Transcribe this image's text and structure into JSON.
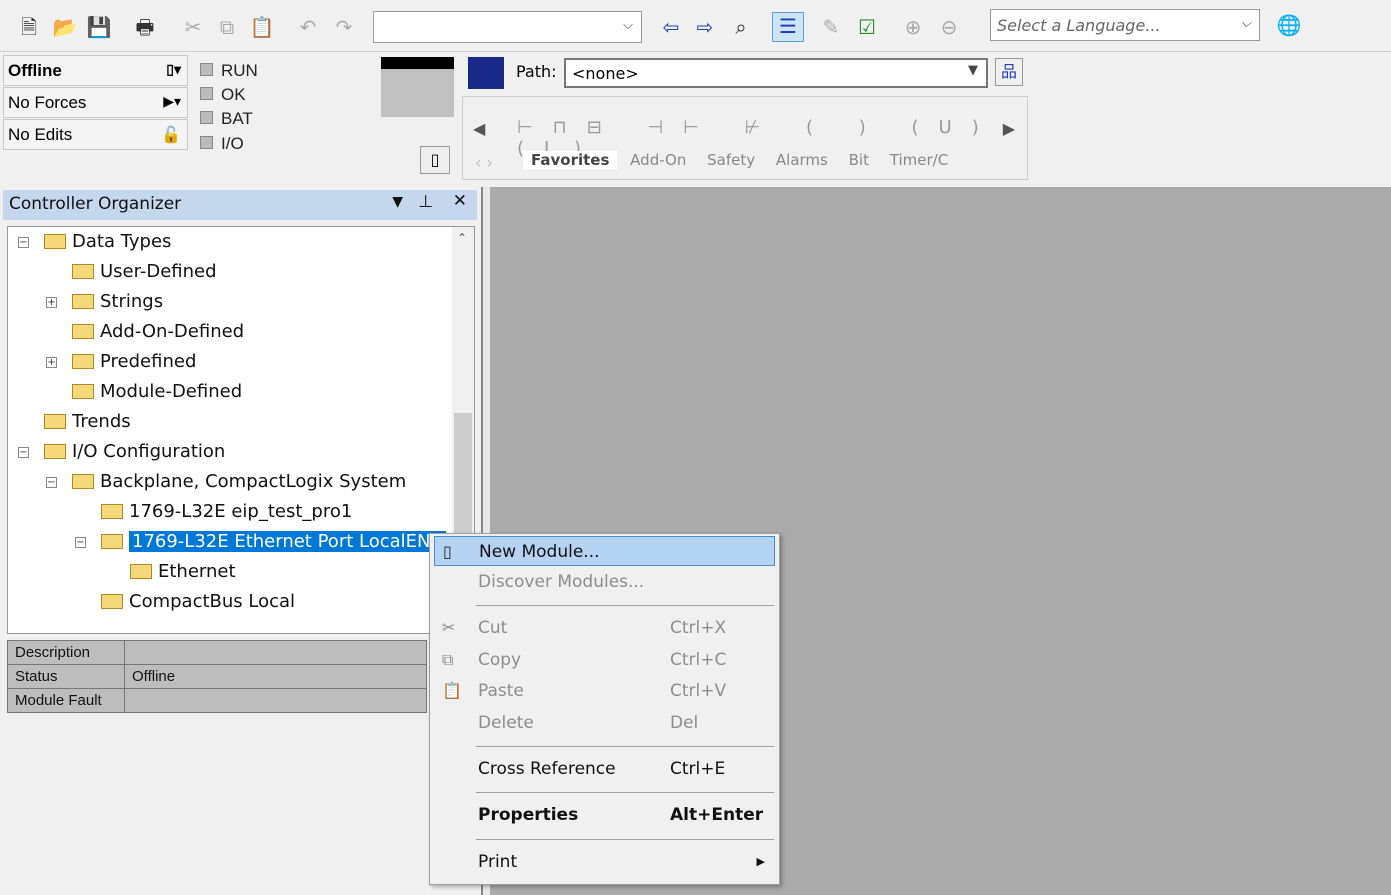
{
  "toolbar": {
    "icons": [
      "new-file",
      "open-folder",
      "save",
      "print",
      "cut",
      "copy",
      "paste",
      "undo",
      "redo",
      "find",
      "find-next",
      "cross-reference",
      "tree-view",
      "verify",
      "verify-controller",
      "zoom-in",
      "zoom-out",
      "globe"
    ],
    "search_value": "",
    "language_placeholder": "Select a Language..."
  },
  "status": {
    "mode": "Offline",
    "forces": "No Forces",
    "edits": "No Edits",
    "indicators": [
      "RUN",
      "OK",
      "BAT",
      "I/O"
    ]
  },
  "path": {
    "label": "Path:",
    "value": "<none>"
  },
  "instruction_tabs": [
    "Favorites",
    "Add-On",
    "Safety",
    "Alarms",
    "Bit",
    "Timer/C"
  ],
  "organizer": {
    "title": "Controller Organizer",
    "tree": [
      {
        "label": "Data Types",
        "level": 0,
        "expander": "minus"
      },
      {
        "label": "User-Defined",
        "level": 1,
        "expander": ""
      },
      {
        "label": "Strings",
        "level": 1,
        "expander": "plus"
      },
      {
        "label": "Add-On-Defined",
        "level": 1,
        "expander": ""
      },
      {
        "label": "Predefined",
        "level": 1,
        "expander": "plus"
      },
      {
        "label": "Module-Defined",
        "level": 1,
        "expander": ""
      },
      {
        "label": "Trends",
        "level": 0,
        "expander": ""
      },
      {
        "label": "I/O Configuration",
        "level": 0,
        "expander": "minus"
      },
      {
        "label": "Backplane, CompactLogix System",
        "level": 1,
        "expander": "minus"
      },
      {
        "label": "1769-L32E eip_test_pro1",
        "level": 2,
        "expander": ""
      },
      {
        "label": "1769-L32E Ethernet Port LocalENB",
        "level": 2,
        "expander": "minus",
        "selected": true
      },
      {
        "label": "Ethernet",
        "level": 3,
        "expander": ""
      },
      {
        "label": "CompactBus Local",
        "level": 2,
        "expander": ""
      }
    ]
  },
  "properties": [
    {
      "name": "Description",
      "value": ""
    },
    {
      "name": "Status",
      "value": "Offline"
    },
    {
      "name": "Module Fault",
      "value": ""
    }
  ],
  "context_menu": [
    {
      "label": "New Module...",
      "shortcut": "",
      "enabled": true,
      "highlighted": true
    },
    {
      "label": "Discover Modules...",
      "shortcut": "",
      "enabled": false
    },
    {
      "label": "Cut",
      "shortcut": "Ctrl+X",
      "enabled": false
    },
    {
      "label": "Copy",
      "shortcut": "Ctrl+C",
      "enabled": false
    },
    {
      "label": "Paste",
      "shortcut": "Ctrl+V",
      "enabled": false
    },
    {
      "label": "Delete",
      "shortcut": "Del",
      "enabled": false
    },
    {
      "label": "Cross Reference",
      "shortcut": "Ctrl+E",
      "enabled": true
    },
    {
      "label": "Properties",
      "shortcut": "Alt+Enter",
      "enabled": true,
      "bold": true
    },
    {
      "label": "Print",
      "shortcut": "",
      "enabled": true,
      "submenu": true
    }
  ]
}
